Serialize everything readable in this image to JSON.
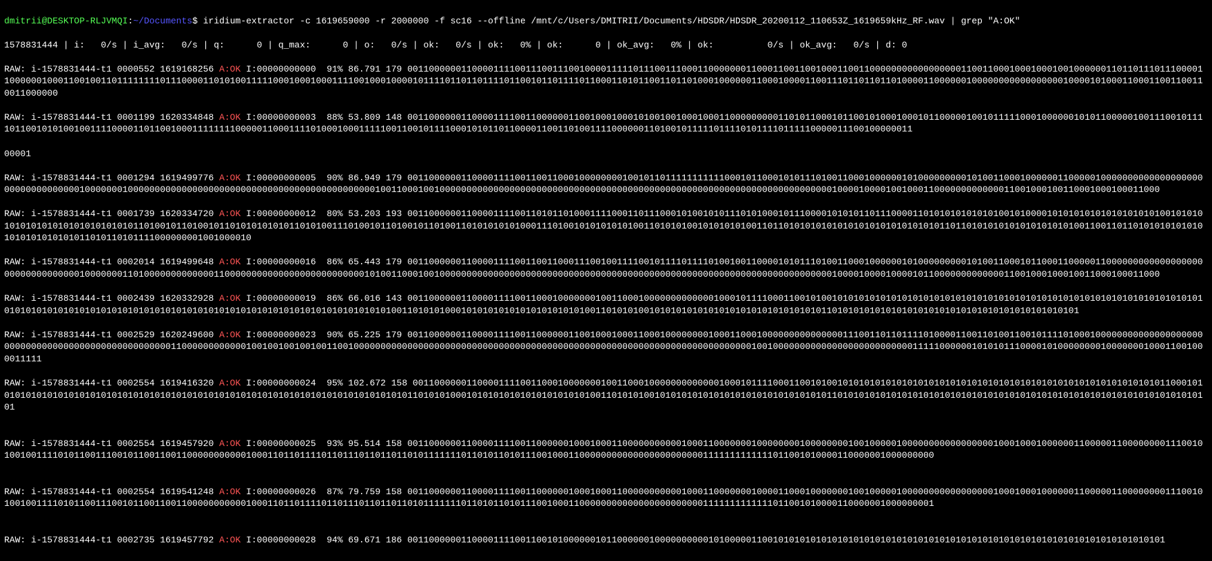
{
  "prompt": {
    "user": "dmitrii",
    "at": "@",
    "host": "DESKTOP-RLJVMQI",
    "colon": ":",
    "path": "~/Documents",
    "dollar": "$"
  },
  "command": "iridium-extractor -c 1619659000 -r 2000000 -f sc16 --offline /mnt/c/Users/DMITRII/Documents/HDSDR/HDSDR_20200112_110653Z_1619659kHz_RF.wav | grep \"A:OK\"",
  "status_line": "1578831444 | i:   0/s | i_avg:   0/s | q:      0 | q_max:      0 | o:   0/s | ok:   0/s | ok:   0% | ok:      0 | ok_avg:   0% | ok:          0/s | ok_avg:   0/s | d: 0",
  "aok_label": "A:OK",
  "records": [
    {
      "pre": "RAW: i-1578831444-t1 0000552 1619168256 ",
      "post": " I:00000000000  91% 86.791 179 001100000011000011110011100111001000011111011100111000110000000110001100110010001100110000000000000000011001100010001000100100000011011011101110000110000001000110010011011111111011100001101010011111000100010001111001000100001011110110110111101100101101111011000110101100110110100010000001100010000110011101101101101000011000000100000000000000000100001010001100011001100110011000000",
      "tail": ""
    },
    {
      "pre": "RAW: i-1578831444-t1 0001199 1620334848 ",
      "post": " I:00000000003  88% 53.809 148 00110000001100001111001100000011001000100010100100100010001100000000011010110001011001010001000101100000100101111100010000001010110000010011100101111011001010100100111100001101100100011111111000001100011110100010001111100110010111100010101101100001100110100111100000011010010111110111101011110111110000011100100000011",
      "tail": "00001"
    },
    {
      "pre": "RAW: i-1578831444-t1 0001294 1619499776 ",
      "post": " I:00000000005  90% 86.949 179 001100000011000011110011001100010000000010010110111111111110001011000101011101001100010000001010000000001010011000100000011000001000000000000000000000000000000000100000001000000000000000000000000000000000000000000000010011000100100000000000000000000000000000000000000000000000000000000000000000000000001000010000100100011000000000000011001000100110001000100011000",
      "tail": ""
    },
    {
      "pre": "RAW: i-1578831444-t1 0001739 1620334720 ",
      "post": " I:00000000012  80% 53.203 193 001100000011000011110011010110100011110001101110001010010101110101000101110000101010110111000011010101010101010010100001010101010101010101010010101010101010101010101010101011010010110100101101010101010110101001110100101101001011010011010101010100011101001010101010100110101010010101010100110110101010101010101010101010101011011010101010101010101010011001101101010101010101010101010101011010110101111000000001001000010",
      "tail": ""
    },
    {
      "pre": "RAW: i-1578831444-t1 0002014 1619499648 ",
      "post": " I:00000000016  86% 65.443 179 001100000011000011110011001100011100100111100101111011110100100110000101011101001100010000001010000000001010011000101100011000001100000000000000000000000000000000100000001101000000000000011000000000000000000000000001010011000100100000000000000000000000000000000000000000000000000000000000000000000000001000010000100001011000000000000011001000100010011000100011000",
      "tail": ""
    },
    {
      "pre": "RAW: i-1578831444-t1 0002439 1620332928 ",
      "post": " I:00000000019  86% 66.016 143 001100000011000011110011000100000001001100010000000000000100010111100011001010010101010101010101010101010101010101010101010101010101010101010101010101010101010101010101010101010101010101010101010101010101010101010101010100110101010001010101010101010101010100110101010010101010101010101010101010101010110101010101010101010101010101010101010101010101",
      "tail": ""
    },
    {
      "pre": "RAW: i-1578831444-t1 0002529 1620249600 ",
      "post": " I:00000000023  90% 65.225 179 001100000011000011110011000000110010001000110001000000001000110001000000000000000111001101101111010000110011010011001011110100010000000000000000000000000000000000000000000000000001100000000000010010010010010011001000000000000000000000000000000000000000000000000000000000000000000000000001001000000000000000000000000001111100000010101011100001010000000010000000100011001000011111",
      "tail": ""
    },
    {
      "pre": "RAW: i-1578831444-t1 0002554 1619416320 ",
      "post": " I:00000000024  95% 102.672 158 001100000011000011110011000100000001001100010000000000000100010111100011001010010101010101010101010101010101010101010101010101010101010101011000101010101010101010101010101010101010101010101010101010101010101010101010101010110101010001010101010101010101010100110101010010101010101010101010101010101010110101010101010101010101010101010101010101010101010101010101010101010101",
      "tail": ""
    },
    {
      "pre": "RAW: i-1578831444-t1 0002554 1619457920 ",
      "post": " I:00000000025  93% 95.514 158 001100000011000011110011000000100010001100000000000100011000000010000000010000000010010000010000000000000000010001000100000011000001100000000111001010010011110101100111001011001100110000000000010001101101111011011101101101101011111110110101101011100100011000000000000000000000001111111111111011001010000110000001000000000",
      "tail": ""
    },
    {
      "pre": "RAW: i-1578831444-t1 0002554 1619541248 ",
      "post": " I:00000000026  87% 79.759 158 001100000011000011110011000000100010001100000000000100011000000010000110001000000010010000010000000000000000010001000100000011000001100000000111001010010011110101100111001011001100110000000000010001101101111011011101101101101011111110110101101011100100011000000000000000000000001111111111111011001010000110000001000000001",
      "tail": ""
    },
    {
      "pre": "RAW: i-1578831444-t1 0002735 1619457792 ",
      "post": " I:00000000028  94% 69.671 186 001100000011000011110011001010000001011000000100000000001010000011001010101010101010101010101010101010101010101010101010101010101010101010101",
      "tail": ""
    }
  ]
}
